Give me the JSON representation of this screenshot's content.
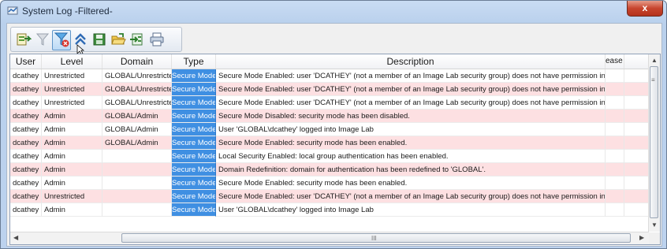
{
  "window": {
    "title": "System Log -Filtered-",
    "close_glyph": "x"
  },
  "toolbar": {
    "buttons": [
      {
        "name": "export-log-button",
        "icon": "export-icon"
      },
      {
        "name": "filter-button",
        "icon": "funnel-icon"
      },
      {
        "name": "clear-filter-button",
        "icon": "funnel-clear-icon",
        "selected": true
      },
      {
        "name": "collapse-button",
        "icon": "double-chevron-up-icon"
      },
      {
        "name": "save-button",
        "icon": "save-icon"
      },
      {
        "name": "open-button",
        "icon": "open-folder-icon"
      },
      {
        "name": "import-button",
        "icon": "import-icon"
      },
      {
        "name": "print-button",
        "icon": "printer-icon"
      }
    ]
  },
  "columns": [
    "User",
    "Level",
    "Domain",
    "Type",
    "Description",
    "ease"
  ],
  "rows": [
    {
      "user": "dcathey",
      "level": "Unrestricted",
      "domain": "GLOBAL/Unrestricted",
      "type": "Secure Mode",
      "description": "Secure Mode Enabled: user 'DCATHEY' (not a member of an Image Lab security group) does not have permission in 'GLOBAL'",
      "pink": false
    },
    {
      "user": "dcathey",
      "level": "Unrestricted",
      "domain": "GLOBAL/Unrestricted",
      "type": "Secure Mode",
      "description": "Secure Mode Enabled: user 'DCATHEY' (not a member of an Image Lab security group) does not have permission in 'GLOBAL'",
      "pink": true
    },
    {
      "user": "dcathey",
      "level": "Unrestricted",
      "domain": "GLOBAL/Unrestricted",
      "type": "Secure Mode",
      "description": "Secure Mode Enabled: user 'DCATHEY' (not a member of an Image Lab security group) does not have permission in 'GLOBAL'",
      "pink": false
    },
    {
      "user": "dcathey",
      "level": "Admin",
      "domain": "GLOBAL/Admin",
      "type": "Secure Mode",
      "description": "Secure Mode Disabled: security mode has been disabled.",
      "pink": true
    },
    {
      "user": "dcathey",
      "level": "Admin",
      "domain": "GLOBAL/Admin",
      "type": "Secure Mode",
      "description": "User 'GLOBAL\\dcathey' logged into Image Lab",
      "pink": false
    },
    {
      "user": "dcathey",
      "level": "Admin",
      "domain": "GLOBAL/Admin",
      "type": "Secure Mode",
      "description": "Secure Mode Enabled: security mode has been enabled.",
      "pink": true
    },
    {
      "user": "dcathey",
      "level": "Admin",
      "domain": "",
      "type": "Secure Mode",
      "description": "Local Security Enabled: local group authentication has been enabled.",
      "pink": false
    },
    {
      "user": "dcathey",
      "level": "Admin",
      "domain": "",
      "type": "Secure Mode",
      "description": "Domain Redefinition: domain for authentication has been redefined to 'GLOBAL'.",
      "pink": true
    },
    {
      "user": "dcathey",
      "level": "Admin",
      "domain": "",
      "type": "Secure Mode",
      "description": "Secure Mode Enabled: security mode has been enabled.",
      "pink": false
    },
    {
      "user": "dcathey",
      "level": "Unrestricted",
      "domain": "",
      "type": "Secure Mode",
      "description": "Secure Mode Enabled: user 'DCATHEY' (not a member of an Image Lab security group) does not have permission in 'GLOBAL'",
      "pink": true
    },
    {
      "user": "dcathey",
      "level": "Admin",
      "domain": "",
      "type": "Secure Mode",
      "description": "User 'GLOBAL\\dcathey' logged into Image Lab",
      "pink": false
    }
  ],
  "scrollbar": {
    "hscroll_grip": "III",
    "vscroll_grip": "≡"
  },
  "colors": {
    "type_cell": "#3f8fe2",
    "alt_row": "#fde0e2",
    "titlebar": "#c9dcf3"
  }
}
